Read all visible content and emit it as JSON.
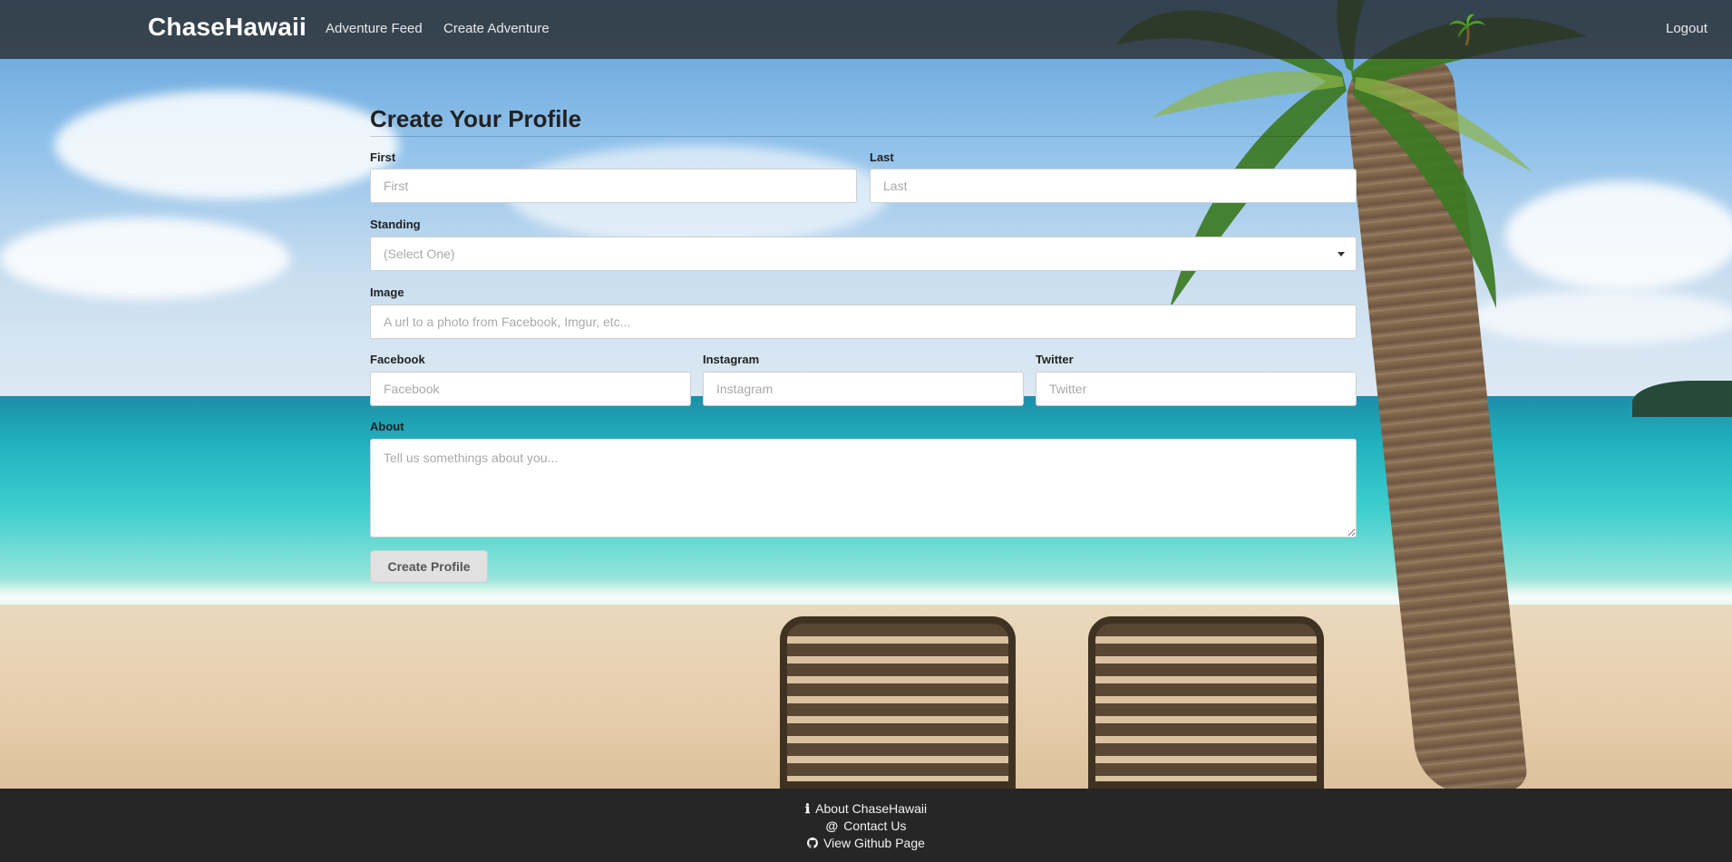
{
  "navbar": {
    "brand": "ChaseHawaii",
    "links": [
      "Adventure Feed",
      "Create Adventure"
    ],
    "logout": "Logout"
  },
  "form": {
    "title": "Create Your Profile",
    "first": {
      "label": "First",
      "placeholder": "First"
    },
    "last": {
      "label": "Last",
      "placeholder": "Last"
    },
    "standing": {
      "label": "Standing",
      "selected": "(Select One)"
    },
    "image": {
      "label": "Image",
      "placeholder": "A url to a photo from Facebook, Imgur, etc..."
    },
    "facebook": {
      "label": "Facebook",
      "placeholder": "Facebook"
    },
    "instagram": {
      "label": "Instagram",
      "placeholder": "Instagram"
    },
    "twitter": {
      "label": "Twitter",
      "placeholder": "Twitter"
    },
    "about": {
      "label": "About",
      "placeholder": "Tell us somethings about you..."
    },
    "submit": "Create Profile"
  },
  "footer": {
    "about": "About ChaseHawaii",
    "contact": "Contact Us",
    "github": "View Github Page"
  },
  "icons": [
    "info-icon",
    "at-icon",
    "github-icon",
    "palm-tree-icon",
    "dropdown-caret-icon"
  ],
  "colors": {
    "navbar": "#282828",
    "footer": "#262626",
    "button": "#e1e1e1"
  }
}
